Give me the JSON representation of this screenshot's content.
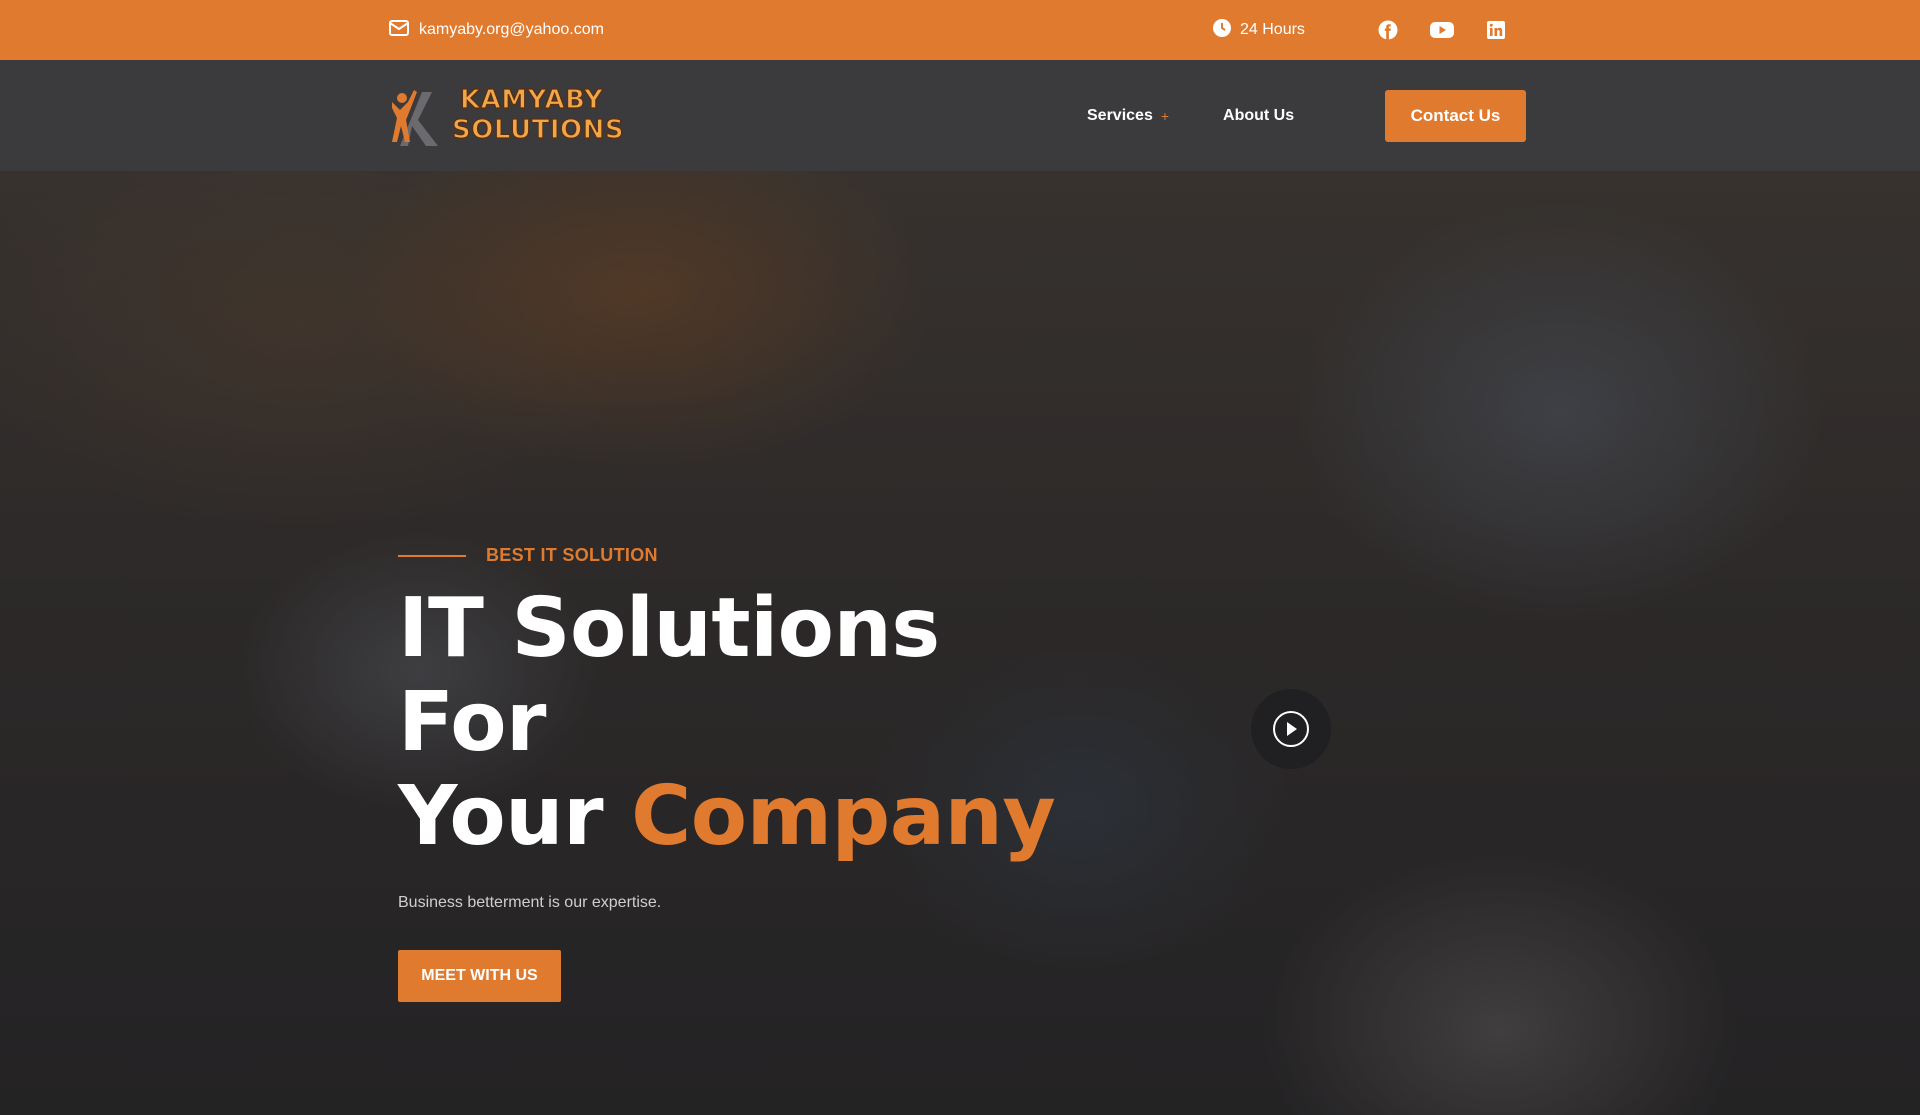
{
  "topbar": {
    "email": "kamyaby.org@yahoo.com",
    "hours": "24 Hours",
    "icons": [
      "mail-icon",
      "clock-icon",
      "facebook-icon",
      "youtube-icon",
      "linkedin-icon"
    ]
  },
  "brand": {
    "line1": "KAMYABY",
    "line2": "SOLUTIONS"
  },
  "nav": {
    "services": "Services",
    "services_toggle": "+",
    "about": "About Us",
    "contact_button": "Contact Us"
  },
  "hero": {
    "eyebrow": "BEST IT SOLUTION",
    "headline_line1": "IT Solutions For",
    "headline_line2_prefix": "Your ",
    "headline_line2_accent": "Company",
    "subtext": "Business betterment is our expertise.",
    "cta": "MEET WITH US"
  },
  "colors": {
    "accent": "#e07a2e",
    "navbar": "#3b3a3d"
  }
}
